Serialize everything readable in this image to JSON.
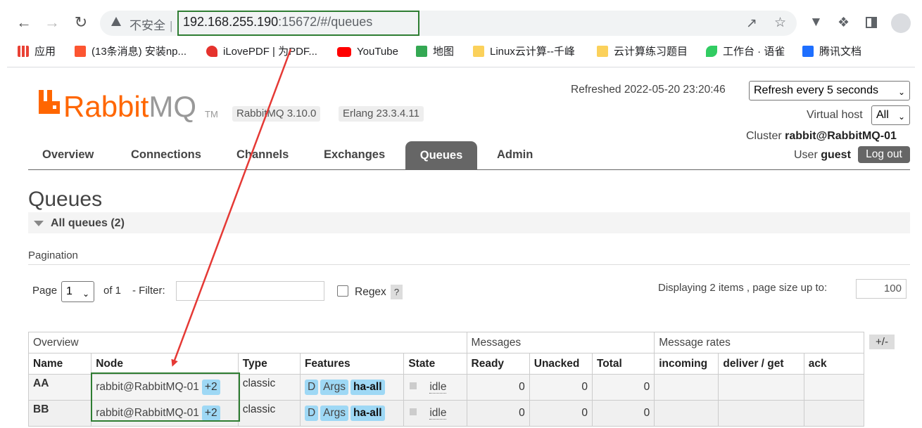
{
  "browser": {
    "security_label": "不安全",
    "url_host": "192.168.255.190",
    "url_rest": ":15672/#/queues",
    "bookmarks": [
      {
        "label": "应用",
        "color": "#e94235"
      },
      {
        "label": "(13条消息) 安装np...",
        "color": "#fc5531"
      },
      {
        "label": "iLovePDF | 为PDF...",
        "color": "#e5322d"
      },
      {
        "label": "YouTube",
        "color": "#ff0000"
      },
      {
        "label": "地图",
        "color": "#34a853"
      },
      {
        "label": "Linux云计算--千峰",
        "color": "#fbd15b"
      },
      {
        "label": "云计算练习题目",
        "color": "#fbd15b"
      },
      {
        "label": "工作台 · 语雀",
        "color": "#31cc62"
      },
      {
        "label": "腾讯文档",
        "color": "#1e6fff"
      }
    ]
  },
  "app": {
    "logo_rabbit": "Rabbit",
    "logo_mq": "MQ",
    "logo_tm": "TM",
    "version": "RabbitMQ 3.10.0",
    "erlang": "Erlang 23.3.4.11",
    "refreshed": "Refreshed 2022-05-20 23:20:46",
    "refresh_option": "Refresh every 5 seconds",
    "vhost_label": "Virtual host",
    "vhost_value": "All",
    "cluster_label": "Cluster",
    "cluster_value": "rabbit@RabbitMQ-01",
    "user_label": "User",
    "user_value": "guest",
    "logout_label": "Log out",
    "accent": "#ff6600"
  },
  "tabs": [
    "Overview",
    "Connections",
    "Channels",
    "Exchanges",
    "Queues",
    "Admin"
  ],
  "page": {
    "title": "Queues",
    "section_title": "All queues (2)",
    "pagination_label": "Pagination",
    "page_label": "Page",
    "page_value": "1",
    "of_label": "of 1",
    "filter_label": "- Filter:",
    "regex_label": "Regex",
    "help": "?",
    "displaying": "Displaying 2 items , page size up to:",
    "page_size": "100",
    "plus_minus": "+/-"
  },
  "table": {
    "groups": [
      "Overview",
      "Messages",
      "Message rates"
    ],
    "headers": [
      "Name",
      "Node",
      "Type",
      "Features",
      "State",
      "Ready",
      "Unacked",
      "Total",
      "incoming",
      "deliver / get",
      "ack"
    ],
    "rows": [
      {
        "name": "AA",
        "node": "rabbit@RabbitMQ-01",
        "node_extra": "+2",
        "type": "classic",
        "f1": "D",
        "f2": "Args",
        "f3": "ha-all",
        "state": "idle",
        "ready": "0",
        "unacked": "0",
        "total": "0"
      },
      {
        "name": "BB",
        "node": "rabbit@RabbitMQ-01",
        "node_extra": "+2",
        "type": "classic",
        "f1": "D",
        "f2": "Args",
        "f3": "ha-all",
        "state": "idle",
        "ready": "0",
        "unacked": "0",
        "total": "0"
      }
    ]
  }
}
